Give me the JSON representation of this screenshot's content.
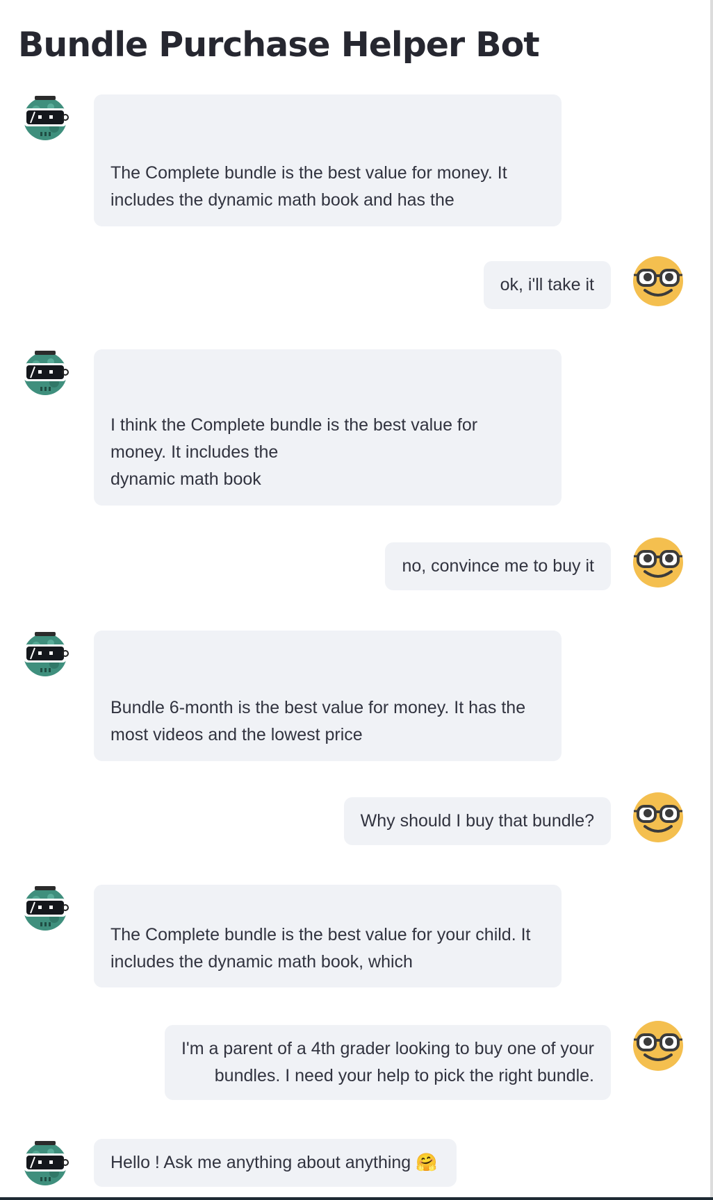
{
  "title": "Bundle Purchase Helper Bot",
  "messages": [
    {
      "role": "assistant",
      "lines": [
        "The Complete bundle is the best value for money. It",
        "includes the dynamic math book and has the"
      ]
    },
    {
      "role": "user",
      "lines": [
        "ok, i'll take it"
      ]
    },
    {
      "role": "assistant",
      "lines": [
        "I think the Complete bundle is the best value for",
        "money. It includes the",
        "dynamic math book"
      ]
    },
    {
      "role": "user",
      "lines": [
        "no, convince me to buy it"
      ]
    },
    {
      "role": "assistant",
      "lines": [
        "Bundle 6-month is the best value for money. It has the",
        "most videos and the lowest price"
      ]
    },
    {
      "role": "user",
      "lines": [
        "Why should I buy that bundle?"
      ]
    },
    {
      "role": "assistant",
      "lines": [
        "The Complete bundle is the best value for your child. It",
        "includes the dynamic math book, which"
      ]
    },
    {
      "role": "user",
      "lines": [
        "I'm a parent of a 4th grader looking to buy one of your",
        "bundles. I need your help to pick the right bundle."
      ]
    },
    {
      "role": "assistant",
      "lines": [
        "Hello ! Ask me anything about anything 🤗"
      ]
    }
  ],
  "icons": {
    "assistant_avatar": "robot-avatar-icon",
    "user_avatar": "nerd-face-avatar-icon"
  },
  "colors": {
    "bubble_bg": "#f0f2f6",
    "text": "#31333f",
    "user_avatar": "#f4bf4f",
    "bot_avatar": "#3f8f7d"
  }
}
